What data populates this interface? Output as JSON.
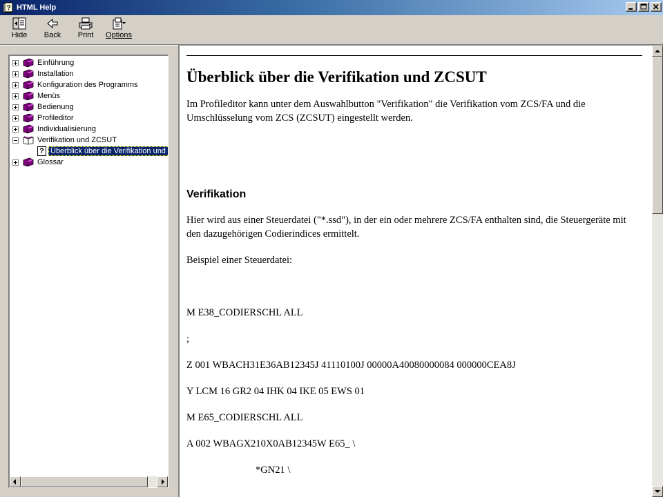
{
  "window": {
    "title": "HTML Help",
    "controls": {
      "minimize": "minimize-icon",
      "maximize": "maximize-icon",
      "close": "close-icon"
    }
  },
  "toolbar": {
    "buttons": [
      {
        "label": "Hide",
        "icon": "hide-pane-icon"
      },
      {
        "label": "Back",
        "icon": "back-arrow-icon"
      },
      {
        "label": "Print",
        "icon": "printer-icon"
      },
      {
        "label": "Options",
        "icon": "options-icon"
      }
    ]
  },
  "tree": {
    "items": [
      {
        "label": "Einführung",
        "icon": "closed-book-icon",
        "expander": "plus"
      },
      {
        "label": "Installation",
        "icon": "closed-book-icon",
        "expander": "plus"
      },
      {
        "label": "Konfiguration des Programms",
        "icon": "closed-book-icon",
        "expander": "plus"
      },
      {
        "label": "Menüs",
        "icon": "closed-book-icon",
        "expander": "plus"
      },
      {
        "label": "Bedienung",
        "icon": "closed-book-icon",
        "expander": "plus"
      },
      {
        "label": "Profileditor",
        "icon": "closed-book-icon",
        "expander": "plus"
      },
      {
        "label": "Individualisierung",
        "icon": "closed-book-icon",
        "expander": "plus"
      },
      {
        "label": "Verifikation und ZCSUT",
        "icon": "open-book-icon",
        "expander": "minus"
      },
      {
        "label": "Überblick über die Verifikation und ZCSUT",
        "icon": "help-page-icon",
        "selected": true
      },
      {
        "label": "Glossar",
        "icon": "closed-book-icon",
        "expander": "plus"
      }
    ]
  },
  "content": {
    "title": "Überblick über die Verifikation und ZCSUT",
    "intro": "Im Profileditor kann unter dem Auswahlbutton \"Verifikation\" die Verifikation vom ZCS/FA und die Umschlüsselung vom ZCS (ZCSUT) eingestellt werden.",
    "section_heading": "Verifikation",
    "section_text": "Hier wird aus einer Steuerdatei (\"*.ssd\"), in der ein oder mehrere ZCS/FA enthalten sind, die Steuergeräte mit den dazugehörigen Codierindices ermittelt.",
    "example_label": "Beispiel einer Steuerdatei:",
    "code_lines": [
      "M E38_CODIERSCHL ALL",
      ";",
      "Z 001 WBACH31E36AB12345J 41110100J 00000A40080000084 000000CEA8J",
      "Y LCM 16 GR2 04 IHK 04 IKE 05 EWS 01",
      "M E65_CODIERSCHL ALL",
      "A 002 WBAGX210X0AB12345W E65_ \\",
      "*GN21 \\"
    ]
  }
}
